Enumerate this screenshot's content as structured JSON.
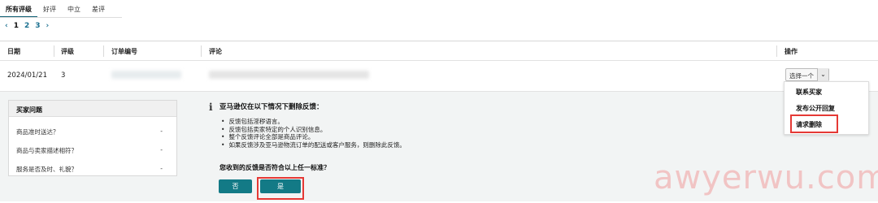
{
  "tabs": [
    "所有评级",
    "好评",
    "中立",
    "差评"
  ],
  "pagination": {
    "prev": "‹",
    "pages": [
      "1",
      "2",
      "3"
    ],
    "next": "›"
  },
  "table": {
    "headers": {
      "date": "日期",
      "rating": "评级",
      "order": "订单编号",
      "comment": "评论",
      "action": "操作"
    },
    "row": {
      "date": "2024/01/21",
      "rating": "3"
    }
  },
  "action_select": {
    "value": "选择一个",
    "chevron": "⌄"
  },
  "action_menu": [
    "联系买家",
    "发布公开回复",
    "请求删除"
  ],
  "buyer_questions": {
    "title": "买家问题",
    "items": [
      {
        "q": "商品准时送达？",
        "a": "-"
      },
      {
        "q": "商品与卖家描述相符？",
        "a": "-"
      },
      {
        "q": "服务是否及时、礼貌？",
        "a": "-"
      }
    ]
  },
  "removal_info": {
    "icon": "i",
    "title": "亚马逊仅在以下情况下删除反馈：",
    "bullets": [
      "反馈包括淫秽语言。",
      "反馈包括卖家特定的个人识别信息。",
      "整个反馈评论全部是商品评论。",
      "如果反馈涉及亚马逊物流订单的配送或客户服务，则删除此反馈。"
    ],
    "question": "您收到的反馈是否符合以上任一标准？",
    "no_label": "否",
    "yes_label": "是"
  },
  "watermark": "awyerwu.com",
  "colors": {
    "accent": "#137a86",
    "highlight": "#e53935",
    "link": "#1a6f8f"
  }
}
